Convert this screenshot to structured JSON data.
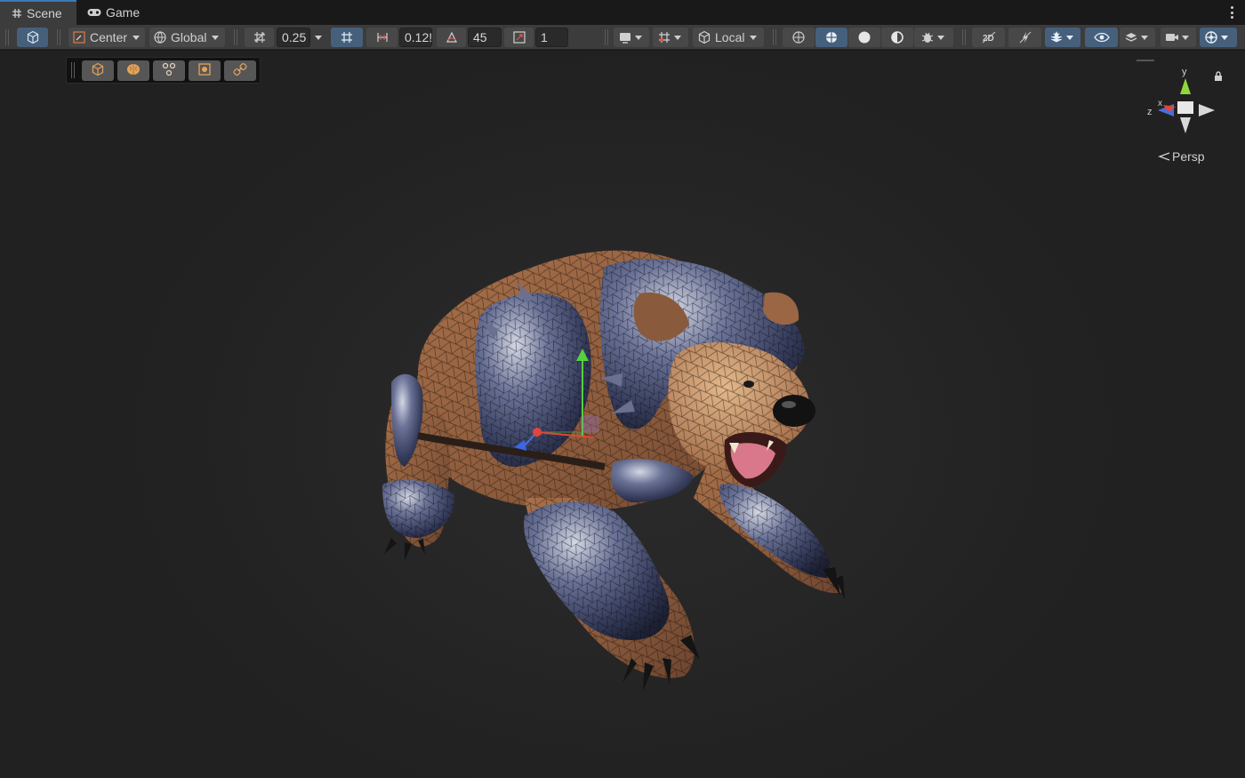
{
  "tabs": [
    {
      "label": "Scene",
      "icon": "hash-grid-icon",
      "active": true
    },
    {
      "label": "Game",
      "icon": "gamepad-icon",
      "active": false
    }
  ],
  "toolbar": {
    "pivot_mode": "Center",
    "pivot_rotation": "Global",
    "grid_snap_value": "0.25",
    "increment_snap_value": "0.12!",
    "rotation_snap_value": "45",
    "scale_snap_value": "1",
    "handle_space": "Local"
  },
  "overlay_tools": [
    "cube-tool-icon",
    "brain-icon",
    "nodes-icon",
    "texture-icon",
    "link-icon"
  ],
  "gizmo": {
    "y_label": "y",
    "x_label": "x",
    "z_label": "z",
    "projection": "Persp",
    "colors": {
      "x": "#e0463c",
      "y": "#8fd83a",
      "z": "#4a6fd8"
    }
  },
  "scene": {
    "object": "armored-bear-mesh",
    "shading": "shaded-wireframe",
    "colors": {
      "fur": "#9a6644",
      "armor": "#3b4364",
      "highlight": "#c8cbd8"
    }
  }
}
